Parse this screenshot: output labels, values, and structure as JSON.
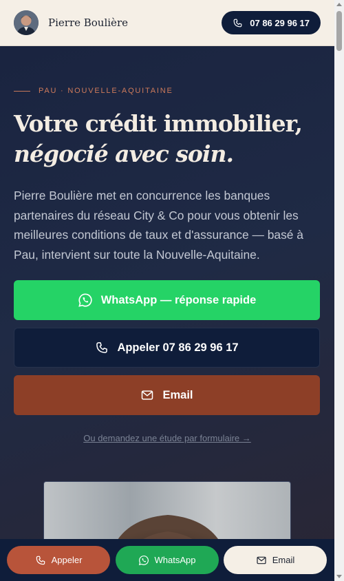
{
  "header": {
    "brand_name": "Pierre Boulière",
    "phone_label": "07 86 29 96 17"
  },
  "hero": {
    "eyebrow": "PAU · NOUVELLE-AQUITAINE",
    "title_line1": "Votre crédit immobilier,",
    "title_line2": "négocié avec soin.",
    "lede": "Pierre Boulière met en concurrence les banques partenaires du réseau City & Co pour vous obtenir les meilleures conditions de taux et d'assurance — basé à Pau, intervient sur toute la Nouvelle-Aquitaine.",
    "cta_whatsapp": "WhatsApp — réponse rapide",
    "cta_call": "Appeler 07 86 29 96 17",
    "cta_email": "Email",
    "form_link": "Ou demandez une étude par formulaire →"
  },
  "bottom_bar": {
    "call": "Appeler",
    "whatsapp": "WhatsApp",
    "email": "Email"
  },
  "icons": {
    "phone": "phone-icon",
    "whatsapp": "whatsapp-icon",
    "mail": "mail-icon"
  },
  "colors": {
    "navy": "#0f1d3a",
    "cream": "#f5efe6",
    "whatsapp_green": "#25d366",
    "terracotta": "#8d3f27",
    "accent": "#cf7b5b"
  }
}
